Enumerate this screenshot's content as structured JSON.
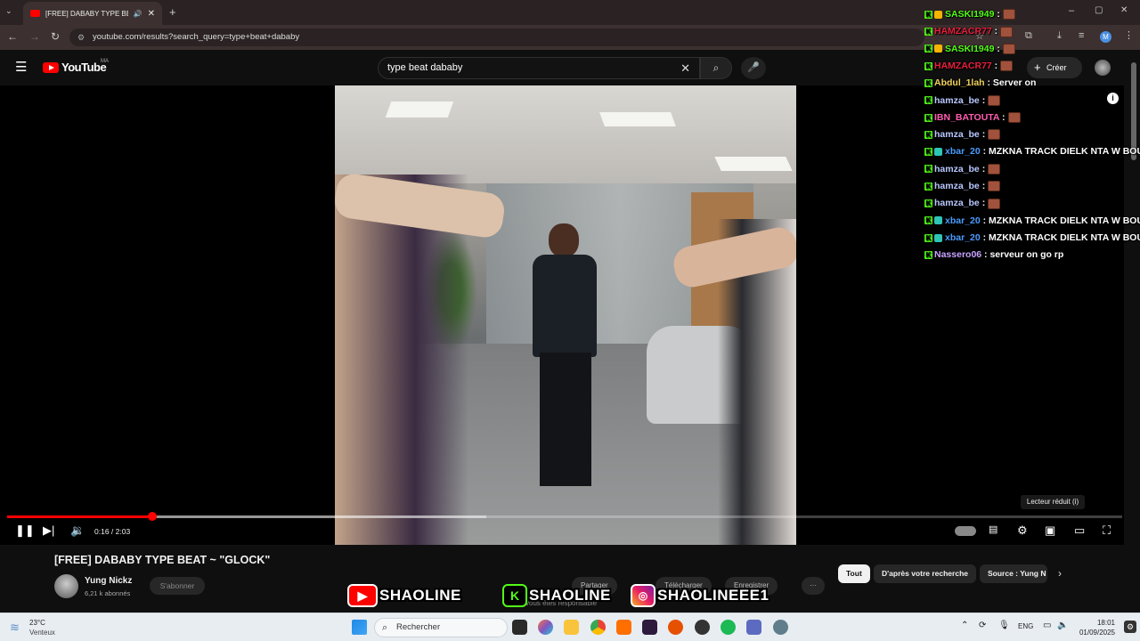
{
  "browser": {
    "tab_title": "[FREE] DABABY TYPE BEAT",
    "url": "youtube.com/results?search_query=type+beat+dababy"
  },
  "youtube": {
    "logo_text": "YouTube",
    "region": "MA",
    "search_value": "type beat dababy",
    "create_label": "Créer"
  },
  "player": {
    "time": "0:16 / 2:03",
    "progress_fraction": 0.13,
    "buffered_fraction": 0.43,
    "tooltip": "Lecteur réduit (i)"
  },
  "video": {
    "title": "[FREE] DABABY TYPE BEAT ~ \"GLOCK\"",
    "channel": "Yung Nickz",
    "subscribers": "6,21 k abonnés",
    "subscribe_label": "S'abonner",
    "share_label": "Partager",
    "download_label": "Télécharger",
    "save_label": "Enregistrer",
    "more_label": "···"
  },
  "chips": [
    {
      "label": "Tout",
      "active": true
    },
    {
      "label": "D'après votre recherche",
      "active": false
    },
    {
      "label": "Source : Yung N",
      "active": false
    }
  ],
  "overlay": {
    "banner": [
      {
        "platform": "youtube",
        "name": "SHAOLINE"
      },
      {
        "platform": "kick",
        "name": "SHAOLINE"
      },
      {
        "platform": "instagram",
        "name": "SHAOLINEEE1"
      }
    ],
    "partial_caption": "vous êtes responsable"
  },
  "chat": [
    {
      "user": "SASKI1949",
      "color": "#53fc18",
      "badge": "#f4b400",
      "message": ":",
      "emote": true
    },
    {
      "user": "HAMZACR77",
      "color": "#e91e3c",
      "badge": "",
      "message": ":",
      "emote": true
    },
    {
      "user": "SASKI1949",
      "color": "#53fc18",
      "badge": "#f4b400",
      "message": ":",
      "emote": true
    },
    {
      "user": "HAMZACR77",
      "color": "#e91e3c",
      "badge": "",
      "message": ":",
      "emote": true
    },
    {
      "user": "Abdul_1lah",
      "color": "#f0d25a",
      "badge": "",
      "message": ": Server on",
      "emote": false
    },
    {
      "user": "hamza_be",
      "color": "#b8c7ff",
      "badge": "",
      "message": ":",
      "emote": true
    },
    {
      "user": "IBN_BATOUTA",
      "color": "#ff5db1",
      "badge": "",
      "message": ":",
      "emote": true
    },
    {
      "user": "hamza_be",
      "color": "#b8c7ff",
      "badge": "",
      "message": ":",
      "emote": true
    },
    {
      "user": "xbar_20",
      "color": "#4a9cff",
      "badge": "#2ec4b6",
      "message": ": MZKNA TRACK DIELK NTA W BOU",
      "emote": false
    },
    {
      "user": "hamza_be",
      "color": "#b8c7ff",
      "badge": "",
      "message": ":",
      "emote": true
    },
    {
      "user": "hamza_be",
      "color": "#b8c7ff",
      "badge": "",
      "message": ":",
      "emote": true
    },
    {
      "user": "hamza_be",
      "color": "#b8c7ff",
      "badge": "",
      "message": ":",
      "emote": true
    },
    {
      "user": "xbar_20",
      "color": "#4a9cff",
      "badge": "#2ec4b6",
      "message": ": MZKNA TRACK DIELK NTA W BOU",
      "emote": false
    },
    {
      "user": "xbar_20",
      "color": "#4a9cff",
      "badge": "#2ec4b6",
      "message": ": MZKNA TRACK DIELK NTA W BOU",
      "emote": false
    },
    {
      "user": "Nassero06",
      "color": "#c8a2ff",
      "badge": "",
      "message": ": serveur on go rp",
      "emote": false
    }
  ],
  "taskbar": {
    "weather_temp": "23°C",
    "weather_desc": "Venteux",
    "search_placeholder": "Rechercher",
    "lang": "ENG",
    "time": "18:01",
    "date": "01/09/2025"
  },
  "colors": {
    "accent": "#ff0000",
    "kick": "#53fc18",
    "bg": "#0f0f0f"
  }
}
